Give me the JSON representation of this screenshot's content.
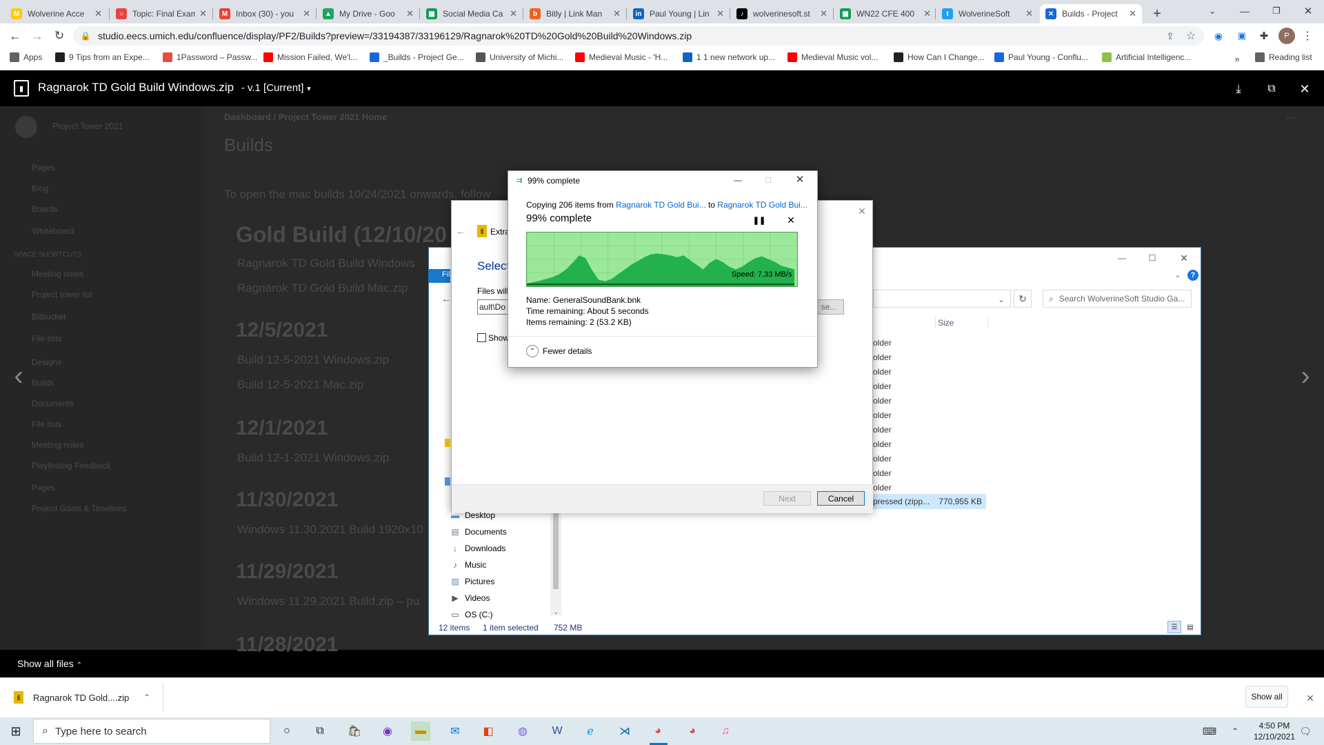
{
  "tabs": [
    {
      "label": "Wolverine Acce",
      "color": "#ffcb05",
      "glyph": "M"
    },
    {
      "label": "Topic: Final Exam",
      "color": "#e8453c",
      "glyph": "○"
    },
    {
      "label": "Inbox (30) - you",
      "color": "#ea4335",
      "glyph": "M"
    },
    {
      "label": "My Drive - Goo",
      "color": "#1fa463",
      "glyph": "▲"
    },
    {
      "label": "Social Media Ca",
      "color": "#0f9d58",
      "glyph": "▦"
    },
    {
      "label": "Bitly | Link Man",
      "color": "#ee6123",
      "glyph": "b"
    },
    {
      "label": "Paul Young | Lin",
      "color": "#0a66c2",
      "glyph": "in"
    },
    {
      "label": "wolverinesoft.st",
      "color": "#000000",
      "glyph": "♪"
    },
    {
      "label": "WN22 CFE 400",
      "color": "#0f9d58",
      "glyph": "▦"
    },
    {
      "label": "WolverineSoft",
      "color": "#1da1f2",
      "glyph": "t"
    },
    {
      "label": "Builds - Project",
      "color": "#1868db",
      "glyph": "✕"
    }
  ],
  "address": {
    "url": "studio.eecs.umich.edu/confluence/display/PF2/Builds?preview=/33194387/33196129/Ragnarok%20TD%20Gold%20Build%20Windows.zip"
  },
  "bookmarks": [
    {
      "label": "Apps",
      "color": "#5f6368"
    },
    {
      "label": "9 Tips from an Expe...",
      "color": "#202124"
    },
    {
      "label": "1Password – Passw...",
      "color": "#e74c3c"
    },
    {
      "label": "Mission Failed, We'l...",
      "color": "#ff0000"
    },
    {
      "label": "_Builds - Project Ge...",
      "color": "#1868db"
    },
    {
      "label": "University of Michi...",
      "color": "#555555"
    },
    {
      "label": "Medieval Music - 'H...",
      "color": "#ff0000"
    },
    {
      "label": "1 1 new network up...",
      "color": "#0a66c2"
    },
    {
      "label": "Medieval Music vol...",
      "color": "#ff0000"
    },
    {
      "label": "How Can I Change...",
      "color": "#202124"
    },
    {
      "label": "Paul Young - Conflu...",
      "color": "#1868db"
    },
    {
      "label": "Artificial Intelligenc...",
      "color": "#8bc34a"
    },
    {
      "label": "Reading list",
      "color": "#5f6368"
    }
  ],
  "viewer": {
    "title": "Ragnarok TD Gold Build Windows.zip",
    "version": "- v.1 [Current]"
  },
  "bg_page": {
    "breadcrumb": "Dashboard  /  Project Tower 2021 Home",
    "space_name": "Project Tower 2021",
    "heading": "Builds",
    "intro": "To open the mac builds 10/24/2021 onwards, follow",
    "sidebar": [
      "Pages",
      "Blog",
      "Boards",
      "Whiteboard",
      "SPACE SHORTCUTS",
      "Meeting notes",
      "Project tower list",
      "Bitbucket",
      "File lists",
      "Designs",
      "Builds",
      "Documents",
      "File lists",
      "Meeting notes",
      "Playtesting Feedback",
      "Pages",
      "Project Goals & Timelines"
    ],
    "sections": [
      {
        "date": "Gold Build (12/10/20",
        "files": [
          "Ragnarok TD Gold Build Windows",
          "Ragnarok TD Gold Build Mac.zip"
        ]
      },
      {
        "date": "12/5/2021",
        "files": [
          "Build 12-5-2021 Windows.zip",
          "Build 12-5-2021 Mac.zip"
        ]
      },
      {
        "date": "12/1/2021",
        "files": [
          "Build 12-1-2021 Windows.zip"
        ]
      },
      {
        "date": "11/30/2021",
        "files": [
          "Windows 11.30.2021 Build 1920x10"
        ]
      },
      {
        "date": "11/29/2021",
        "files": [
          "Windows 11.29.2021 Build.zip – pu"
        ]
      },
      {
        "date": "11/28/2021",
        "files": []
      }
    ]
  },
  "explorer": {
    "search_placeholder": "Search WolverineSoft Studio Ga...",
    "size_header": "Size",
    "rows": [
      "older",
      "older",
      "older",
      "older",
      "older",
      "older",
      "older",
      "older",
      "older",
      "older",
      "older"
    ],
    "zip_row": {
      "type": "pressed (zipp...",
      "size": "770,955 KB"
    },
    "file_tab": "File",
    "nav": [
      "Desktop",
      "Documents",
      "Downloads",
      "Music",
      "Pictures",
      "Videos",
      "OS (C:)"
    ],
    "status": {
      "items": "12 items",
      "selected": "1 item selected",
      "size": "752 MB"
    }
  },
  "wizard": {
    "title": "Extra",
    "heading": "Select",
    "files_label": "Files will",
    "path_value": "ault\\Do",
    "browse_label": "se...",
    "show_label": "Show",
    "next_label": "Next",
    "cancel_label": "Cancel"
  },
  "progress": {
    "title": "99% complete",
    "copying_prefix": "Copying 206 items from",
    "source": "Ragnarok TD Gold Bui...",
    "to": "to",
    "dest": "Ragnarok TD Gold Bui...",
    "percent_label": "99% complete",
    "percent": 99,
    "speed": "Speed: 7.33 MB/s",
    "name_label": "Name:",
    "name": "GeneralSoundBank.bnk",
    "time_label": "Time remaining:",
    "time": "About 5 seconds",
    "items_label": "Items remaining:",
    "items": "2 (53.2 KB)",
    "fewer": "Fewer details",
    "graph": [
      0.0,
      0.03,
      0.06,
      0.1,
      0.14,
      0.2,
      0.3,
      0.44,
      0.6,
      0.54,
      0.28,
      0.08,
      0.05,
      0.1,
      0.2,
      0.3,
      0.4,
      0.48,
      0.56,
      0.62,
      0.64,
      0.62,
      0.6,
      0.56,
      0.6,
      0.5,
      0.4,
      0.3,
      0.44,
      0.52,
      0.46,
      0.36,
      0.3,
      0.36,
      0.46,
      0.54,
      0.58,
      0.52,
      0.46,
      0.38,
      0.34,
      0.3
    ]
  },
  "filebar": {
    "label": "Show all files"
  },
  "shelf": {
    "file": "Ragnarok TD Gold....zip",
    "show_all": "Show all"
  },
  "taskbar": {
    "search_placeholder": "Type here to search",
    "time": "4:50 PM",
    "date": "12/10/2021"
  },
  "colors": {
    "accent": "#0078d7",
    "graph_fill": "#22b14c",
    "graph_bg": "#9be89b",
    "link": "#0066cc"
  }
}
